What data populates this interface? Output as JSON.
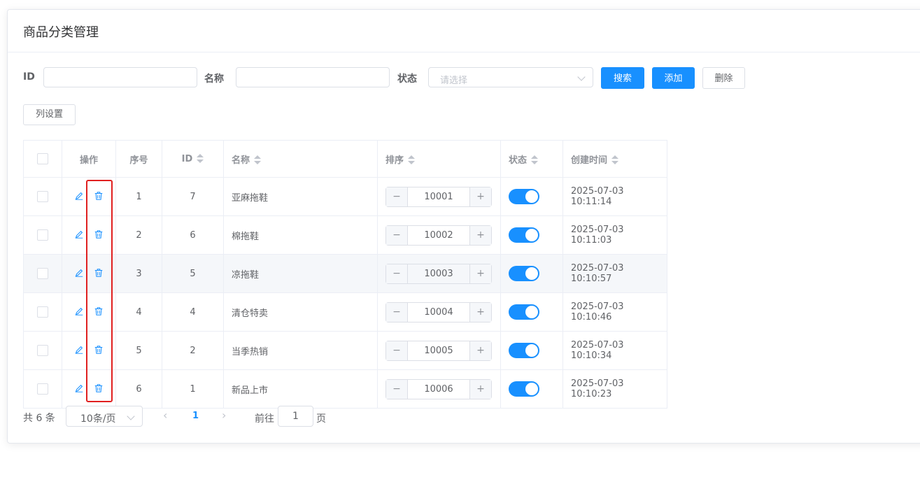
{
  "page": {
    "title": "商品分类管理"
  },
  "filters": {
    "id_label": "ID",
    "id_value": "",
    "name_label": "名称",
    "name_value": "",
    "status_label": "状态",
    "status_placeholder": "请选择"
  },
  "buttons": {
    "search": "搜索",
    "add": "添加",
    "delete": "删除",
    "column_settings": "列设置"
  },
  "table": {
    "columns": [
      "操作",
      "序号",
      "ID",
      "名称",
      "排序",
      "状态",
      "创建时间"
    ],
    "rows": [
      {
        "index": "1",
        "id": "7",
        "name": "亚麻拖鞋",
        "sort": "10001",
        "enabled": true,
        "created": "2025-07-03 10:11:14"
      },
      {
        "index": "2",
        "id": "6",
        "name": "棉拖鞋",
        "sort": "10002",
        "enabled": true,
        "created": "2025-07-03 10:11:03"
      },
      {
        "index": "3",
        "id": "5",
        "name": "凉拖鞋",
        "sort": "10003",
        "enabled": true,
        "created": "2025-07-03 10:10:57"
      },
      {
        "index": "4",
        "id": "4",
        "name": "清仓特卖",
        "sort": "10004",
        "enabled": true,
        "created": "2025-07-03 10:10:46"
      },
      {
        "index": "5",
        "id": "2",
        "name": "当季热销",
        "sort": "10005",
        "enabled": true,
        "created": "2025-07-03 10:10:34"
      },
      {
        "index": "6",
        "id": "1",
        "name": "新品上市",
        "sort": "10006",
        "enabled": true,
        "created": "2025-07-03 10:10:23"
      }
    ],
    "stepper_minus": "−",
    "stepper_plus": "+"
  },
  "pagination": {
    "total": "共 6 条",
    "page_size": "10条/页",
    "current_page": "1",
    "goto_prefix": "前往",
    "goto_value": "1",
    "goto_suffix": "页"
  },
  "colors": {
    "accent": "#1890ff",
    "highlight": "#e02020"
  },
  "icons": {
    "edit": "pencil-icon",
    "delete": "trash-icon",
    "prev": "chevron-left-icon",
    "next": "chevron-right-icon"
  }
}
